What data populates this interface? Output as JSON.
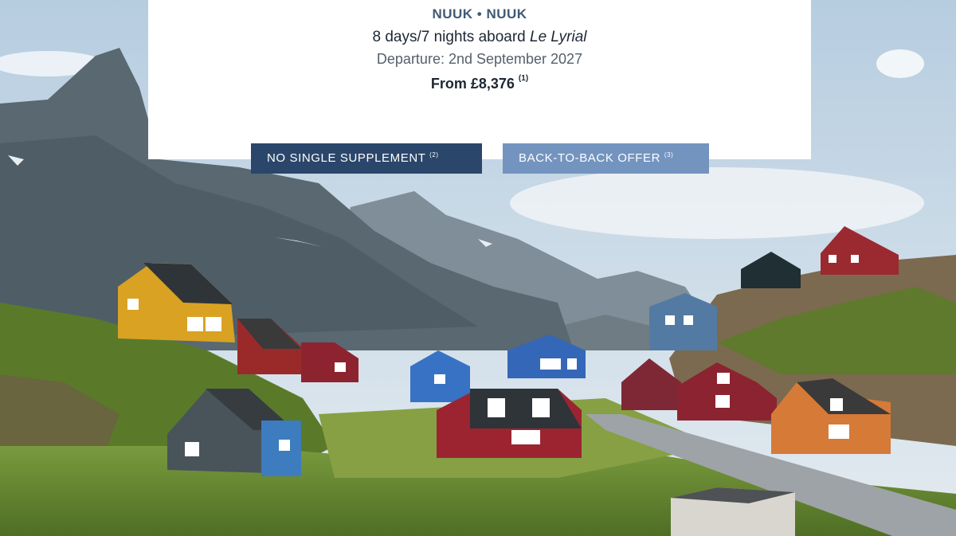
{
  "cruise": {
    "route": "NUUK • NUUK",
    "duration_prefix": "8 days/7 nights aboard ",
    "ship": "Le Lyrial",
    "departure": "Departure: 2nd September 2027",
    "price": "From £8,376",
    "price_note": "(1)"
  },
  "badges": {
    "single_label": "NO SINGLE SUPPLEMENT",
    "single_note": "(2)",
    "b2b_label": "BACK-TO-BACK OFFER",
    "b2b_note": "(3)"
  },
  "colors": {
    "primary": "#2b466b",
    "secondary": "#7394bf",
    "route_text": "#3f5a74"
  }
}
